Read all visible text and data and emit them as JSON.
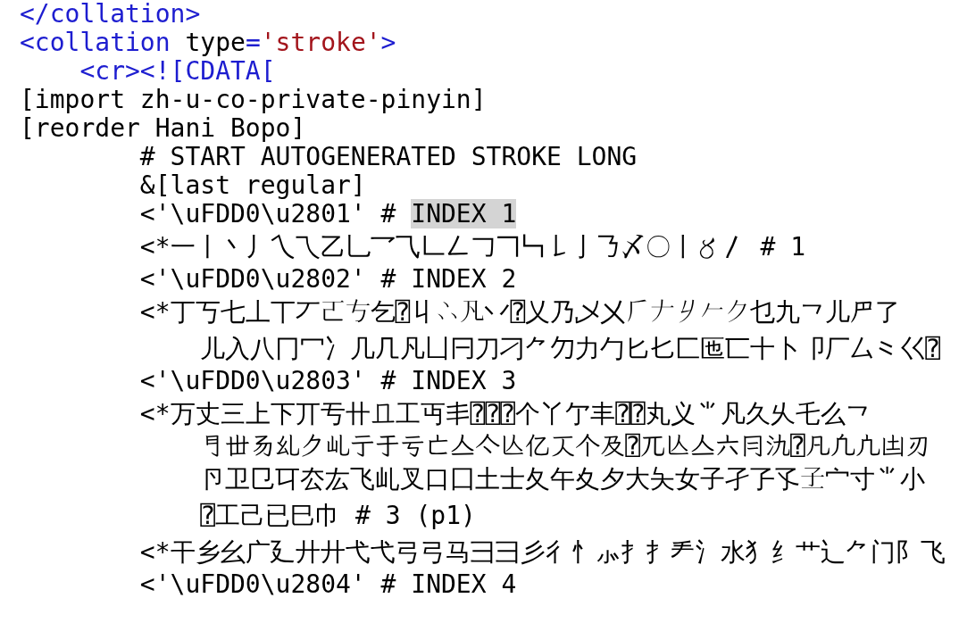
{
  "editor": {
    "lines": [
      {
        "tokens": [
          {
            "kind": "tag",
            "text": "</collation>",
            "selected": false
          }
        ]
      },
      {
        "tokens": [
          {
            "kind": "tag",
            "text": "<collation",
            "selected": false
          },
          {
            "kind": "attr",
            "text": " type",
            "selected": false
          },
          {
            "kind": "tag",
            "text": "=",
            "selected": false
          },
          {
            "kind": "value",
            "text": "'stroke'",
            "selected": false
          },
          {
            "kind": "tag",
            "text": ">",
            "selected": false
          }
        ],
        "children": [
          {
            "tokens": [
              {
                "kind": "tag",
                "text": "<cr><![CDATA[",
                "selected": false
              }
            ]
          }
        ]
      },
      {
        "tokens": [
          {
            "kind": "text",
            "text": "[import zh-u-co-private-pinyin]",
            "selected": false
          }
        ]
      },
      {
        "tokens": [
          {
            "kind": "text",
            "text": "[reorder Hani Bopo]",
            "selected": false
          }
        ]
      },
      {
        "children": [
          {
            "children": [
              {
                "tokens": [
                  {
                    "kind": "text",
                    "text": "# START AUTOGENERATED STROKE LONG",
                    "selected": false
                  }
                ]
              },
              {
                "tokens": [
                  {
                    "kind": "text",
                    "text": "&[last regular]",
                    "selected": false
                  }
                ]
              },
              {
                "tokens": [
                  {
                    "kind": "text",
                    "text": "<'\\uFDD0\\u2801' # ",
                    "selected": false
                  },
                  {
                    "kind": "text",
                    "text": "INDEX 1",
                    "selected": true
                  }
                ]
              },
              {
                "tokens": [
                  {
                    "kind": "text",
                    "text": "<*一丨丶丿乀乁乙乚乛⺄𠃊𠃋𠃌𠃍𠃑𠄌亅𠄎〆〇〡〥〳 # 1",
                    "selected": false
                  }
                ]
              },
              {
                "tokens": [
                  {
                    "kind": "text",
                    "text": "<'\\uFDD0\\u2802' # INDEX 2",
                    "selected": false
                  }
                ]
              },
              {
                "tokens": [
                  {
                    "kind": "text",
                    "text": "<*丁丂七丄丅丆𠀀𠀁乞⍰丩𠁼𠁽丷⍰乂乃乄㐅𠂆𠂇𠂈𠂉𠂊乜九⺂儿𠃜了",
                    "selected": false
                  }
                ],
                "children": [
                  {
                    "tokens": [
                      {
                        "kind": "text",
                        "text": "儿入八冂冖冫几𠘧凡凵𠔼刀刁⺈𠚣力勹匕𠤎匚匜匸十卜卩厂厶⺀巜⍰",
                        "selected": false
                      }
                    ]
                  }
                ]
              },
              {
                "tokens": [
                  {
                    "kind": "text",
                    "text": "<'\\uFDD0\\u2803' # INDEX 3",
                    "selected": false
                  }
                ]
              },
              {
                "tokens": [
                  {
                    "kind": "text",
                    "text": "<*万丈三上下丌亐卄𠀃工丏丯⍰⍰⍰个丫亇丰⍰⍰丸义⺌凡久乆乇么⺂",
                    "selected": false
                  }
                ],
                "children": [
                  {
                    "tokens": [
                      {
                        "kind": "text",
                        "text": "𠃛丗𠃓乣𠂊乢亍于亏亡亼亽亾亿𠆣个及⍰兀亾亼六冃氿⍰凡凢凣凷刃",
                        "selected": false
                      }
                    ]
                  },
                  {
                    "tokens": [
                      {
                        "kind": "text",
                        "text": "卪卫㔾㔿厺厷飞乢叉口囗土士夂午夊夕大夨女子孑孒孓𡤽宀寸⺌小",
                        "selected": false
                      }
                    ]
                  },
                  {
                    "tokens": [
                      {
                        "kind": "text",
                        "text": "⍰工己已巳巾 # 3 (p1)",
                        "selected": false
                      }
                    ]
                  }
                ]
              },
              {
                "tokens": [
                  {
                    "kind": "text",
                    "text": "<*干乡幺广廴廾⼶弋⼷弓⼸马彐⺕彡彳忄⺗扌⺘龵氵水犭纟艹⻌⺈门阝飞",
                    "selected": false
                  }
                ]
              },
              {
                "tokens": [
                  {
                    "kind": "text",
                    "text": "<'\\uFDD0\\u2804' # INDEX 4",
                    "selected": false
                  }
                ]
              }
            ]
          }
        ]
      }
    ]
  }
}
